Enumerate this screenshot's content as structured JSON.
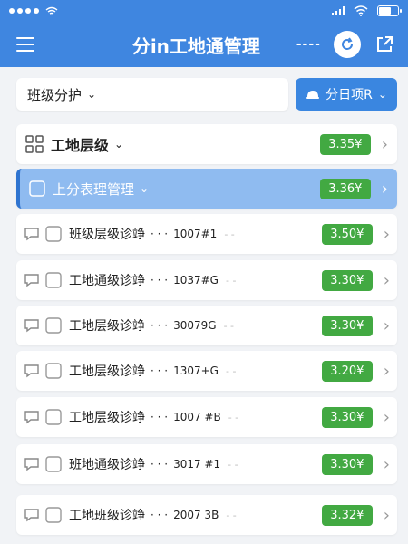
{
  "header": {
    "title": "分in工地通管理",
    "more_label": "----"
  },
  "filter": {
    "select_label": "班级分护",
    "button_label": "分日项R"
  },
  "groups": [
    {
      "label": "工地层级",
      "price": "3.35¥"
    },
    {
      "label": "上分表理管理",
      "price": "3.36¥"
    }
  ],
  "items": [
    {
      "name": "班级层级诊竫",
      "code": "1007#1",
      "price": "3.50¥"
    },
    {
      "name": "工地通级诊竫",
      "code": "1037#G",
      "price": "3.30¥"
    },
    {
      "name": "工地层级诊竫",
      "code": "30079G",
      "price": "3.30¥"
    },
    {
      "name": "工地层级诊竫",
      "code": "1307+G",
      "price": "3.20¥"
    },
    {
      "name": "工地层级诊竫",
      "code": "1007 #B",
      "price": "3.30¥"
    },
    {
      "name": "班地通级诊竫",
      "code": "3017 #1",
      "price": "3.30¥"
    },
    {
      "name": "工地班级诊竫",
      "code": "2007 3B",
      "price": "3.32¥"
    }
  ],
  "dots_label": "· · ·",
  "dash_label": "- -",
  "colors": {
    "primary": "#3f86e0",
    "selected": "#8fbbf0",
    "badge_green": "#42a942"
  }
}
